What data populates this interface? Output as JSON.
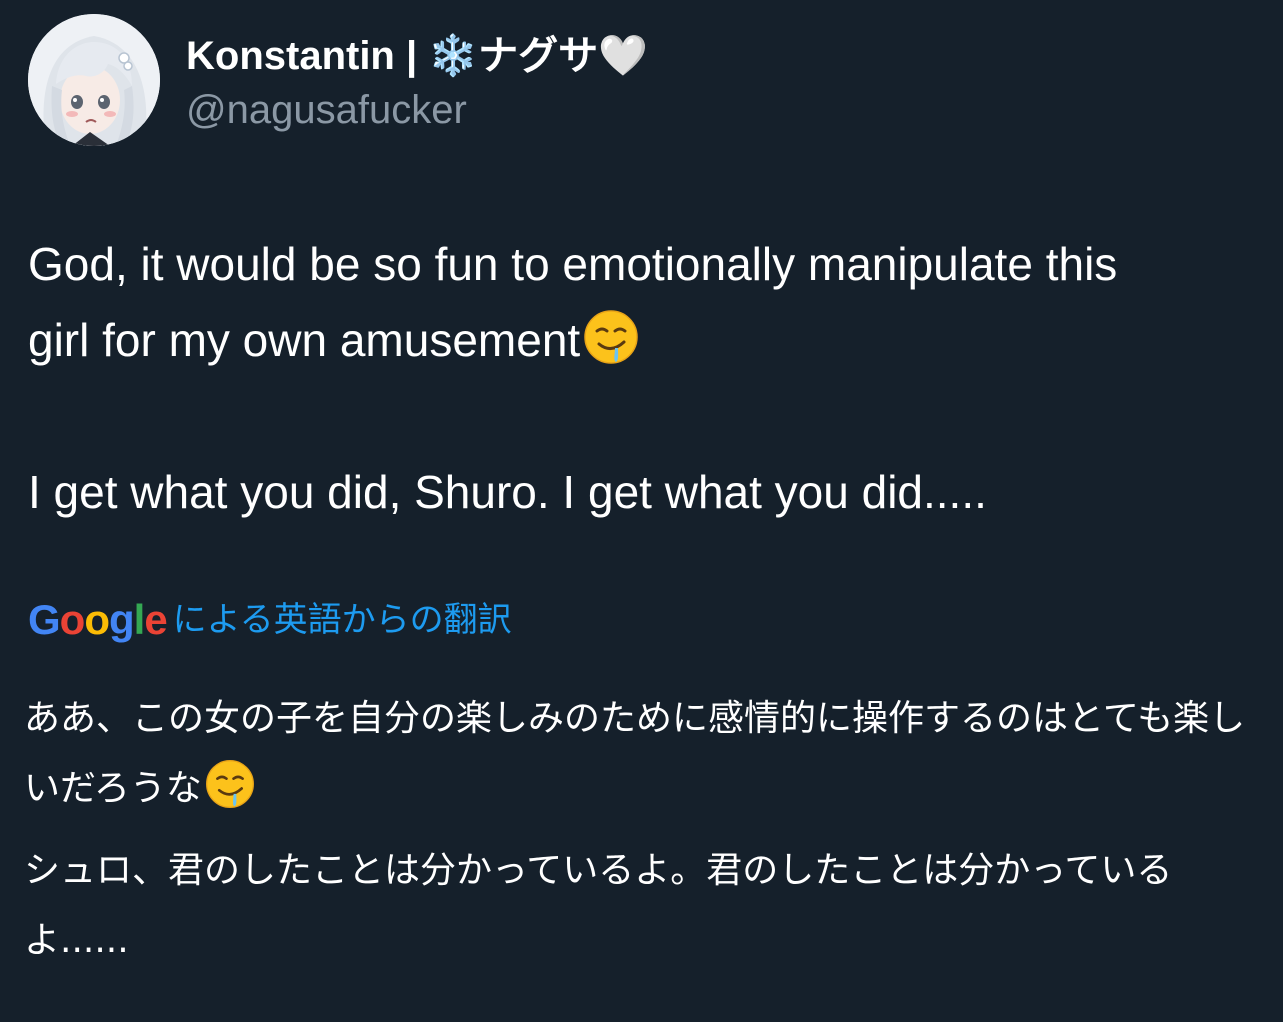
{
  "author": {
    "display_name": "Konstantin | ❄️ナグサ🤍",
    "handle": "@nagusafucker",
    "avatar_icon": "anime-avatar-icon"
  },
  "tweet": {
    "line1": "God, it would be so fun to emotionally manipulate this",
    "line2": "girl for my own amusement",
    "emoji": "drooling-face-icon",
    "line3": "I get what you did, Shuro. I get what you did....."
  },
  "translation": {
    "provider_letters": [
      "G",
      "o",
      "o",
      "g",
      "l",
      "e"
    ],
    "label": "による英語からの翻訳",
    "paragraph1": "ああ、この女の子を自分の楽しみのために感情的に操作するのはとても楽しいだろうな",
    "paragraph2": "シュロ、君のしたことは分かっているよ。君のしたことは分かっているよ......"
  },
  "colors": {
    "background": "#15202b",
    "text": "#ffffff",
    "handle": "#8b98a5",
    "link": "#1d9bf0"
  }
}
